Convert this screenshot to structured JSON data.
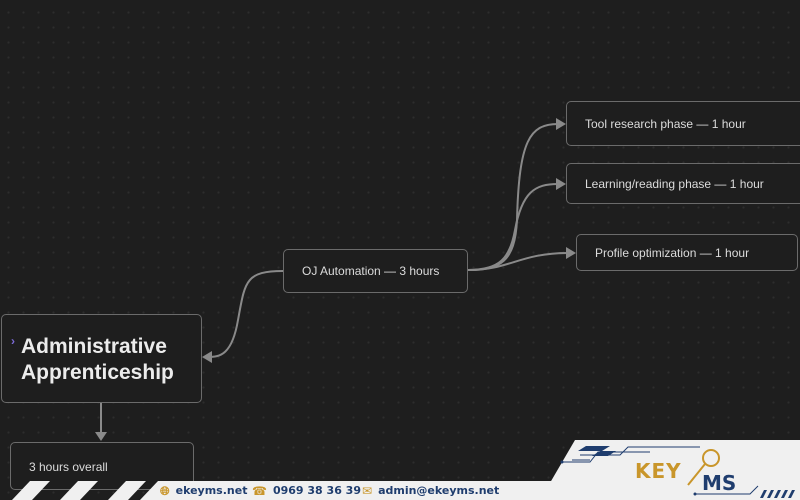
{
  "mindmap": {
    "root": {
      "label_line1": "Administrative",
      "label_line2": "Apprenticeship",
      "collapse_icon": "chevron-right-icon"
    },
    "nodes": {
      "oj": "OJ Automation — 3 hours",
      "tool": "Tool research phase — 1 hour",
      "learn": "Learning/reading phase — 1 hour",
      "profile": "Profile optimization — 1 hour",
      "hours": "3 hours overall"
    },
    "colors": {
      "background": "#1e1e1e",
      "node_border": "#6b6b6b",
      "edge": "#8a8a8a",
      "text": "#dcdcdc",
      "collapse_accent": "#7c6bd6"
    }
  },
  "footer": {
    "website": "ekeyms.net",
    "phone": "0969 38 36 39",
    "email": "admin@ekeyms.net",
    "logo_text_left": "KEY",
    "logo_text_right": "MS",
    "colors": {
      "navy": "#1f3d6e",
      "gold": "#c9962b",
      "panel": "#f0f0f0"
    }
  }
}
